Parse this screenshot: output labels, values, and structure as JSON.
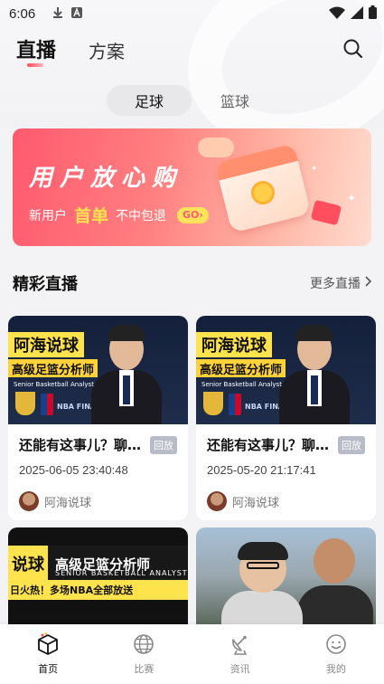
{
  "status_bar": {
    "time": "6:06",
    "icons": [
      "download-icon",
      "a-icon",
      "wifi-icon",
      "signal-icon",
      "battery-icon"
    ]
  },
  "header": {
    "tabs": [
      {
        "label": "直播",
        "active": true
      },
      {
        "label": "方案",
        "active": false
      }
    ],
    "search_icon": "search-icon"
  },
  "sport_switch": {
    "options": [
      {
        "label": "足球",
        "active": true
      },
      {
        "label": "篮球",
        "active": false
      }
    ]
  },
  "banner": {
    "title": "用户放心购",
    "sub_prefix": "新用户",
    "sub_accent": "首单",
    "sub_suffix": "不中包退",
    "go_label": "GO"
  },
  "section": {
    "title": "精彩直播",
    "more_label": "更多直播"
  },
  "cards": [
    {
      "thumb_title": "阿海说球",
      "thumb_sub": "高级足篮分析师",
      "thumb_en": "Senior Basketball Analyst",
      "thumb_finals": "NBA FINALS",
      "title": "还能有这事儿？聊…",
      "badge": "回放",
      "time": "2025-06-05 23:40:48",
      "author": "阿海说球"
    },
    {
      "thumb_title": "阿海说球",
      "thumb_sub": "高级足篮分析师",
      "thumb_en": "Senior Basketball Analyst",
      "thumb_finals": "NBA FINALS",
      "title": "还能有这事儿？聊…",
      "badge": "回放",
      "time": "2025-05-20 21:17:41",
      "author": "阿海说球"
    }
  ],
  "lower_cards": {
    "left": {
      "t1": "说球",
      "t2": "高级足篮分析师",
      "en": "SENIOR BASKETBALL ANALYST",
      "strip": "日火热！多场NBA全部放送"
    }
  },
  "bottom_nav": [
    {
      "label": "首页",
      "icon": "home-box-icon",
      "active": true
    },
    {
      "label": "比赛",
      "icon": "globe-icon",
      "active": false
    },
    {
      "label": "资讯",
      "icon": "satellite-dish-icon",
      "active": false
    },
    {
      "label": "我的",
      "icon": "smile-icon",
      "active": false
    }
  ],
  "colors": {
    "accent": "#ff4c5b",
    "banner_start": "#ff5a6e",
    "banner_accent": "#ffe14f",
    "replay_badge": "#b8bcc6"
  }
}
